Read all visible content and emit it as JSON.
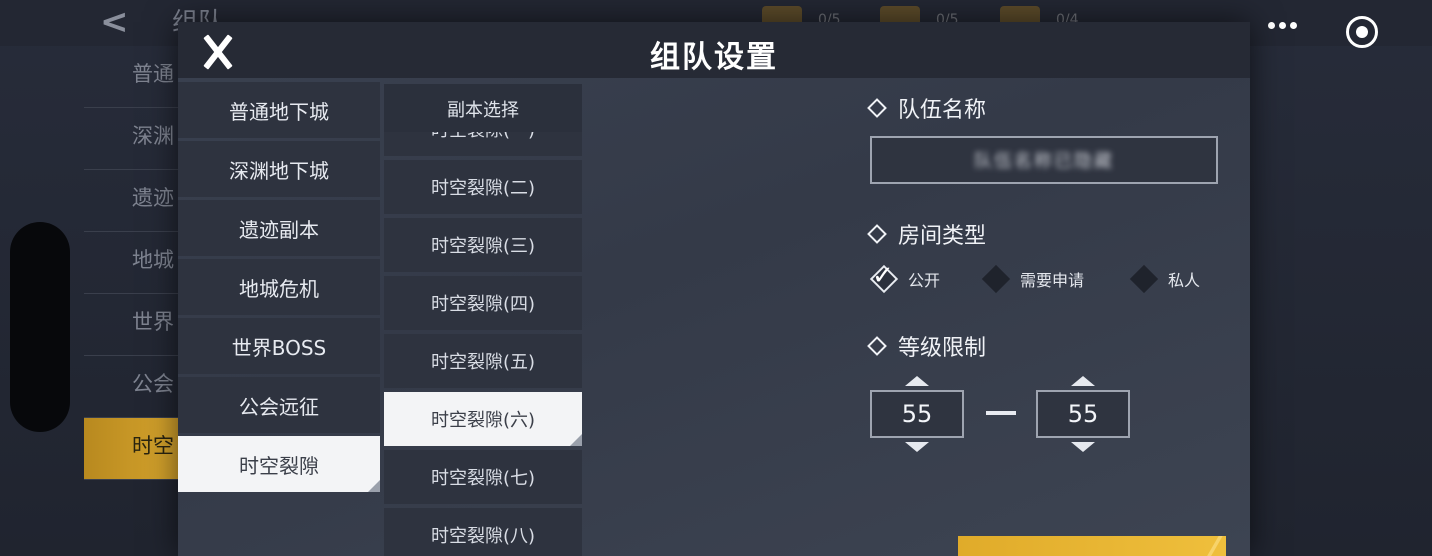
{
  "background": {
    "title": "组队",
    "left_items": [
      "普通",
      "深渊",
      "遗迹",
      "地城",
      "世界",
      "公会",
      "时空"
    ],
    "resources": [
      {
        "icon": "chest-icon",
        "count": "0/5"
      },
      {
        "icon": "chest-icon",
        "count": "0/5"
      },
      {
        "icon": "chest-icon",
        "count": "0/4"
      }
    ]
  },
  "dialog": {
    "title": "组队设置",
    "categories": [
      "普通地下城",
      "深渊地下城",
      "遗迹副本",
      "地城危机",
      "世界BOSS",
      "公会远征",
      "时空裂隙"
    ],
    "selected_category": "时空裂隙",
    "dungeon_header": "副本选择",
    "dungeons": [
      "时空裂隙(一)",
      "时空裂隙(二)",
      "时空裂隙(三)",
      "时空裂隙(四)",
      "时空裂隙(五)",
      "时空裂隙(六)",
      "时空裂隙(七)",
      "时空裂隙(八)"
    ],
    "selected_dungeon": "时空裂隙(六)",
    "team_name": {
      "label": "队伍名称",
      "value": "队伍名称已隐藏"
    },
    "room_type": {
      "label": "房间类型",
      "options": [
        "公开",
        "需要申请",
        "私人"
      ],
      "selected": "公开"
    },
    "level_limit": {
      "label": "等级限制",
      "min": "55",
      "max": "55"
    }
  },
  "colors": {
    "accent": "#e0ab2a",
    "dialog_bg": "#3a4150",
    "selected_item_bg": "#f3f4f6"
  }
}
